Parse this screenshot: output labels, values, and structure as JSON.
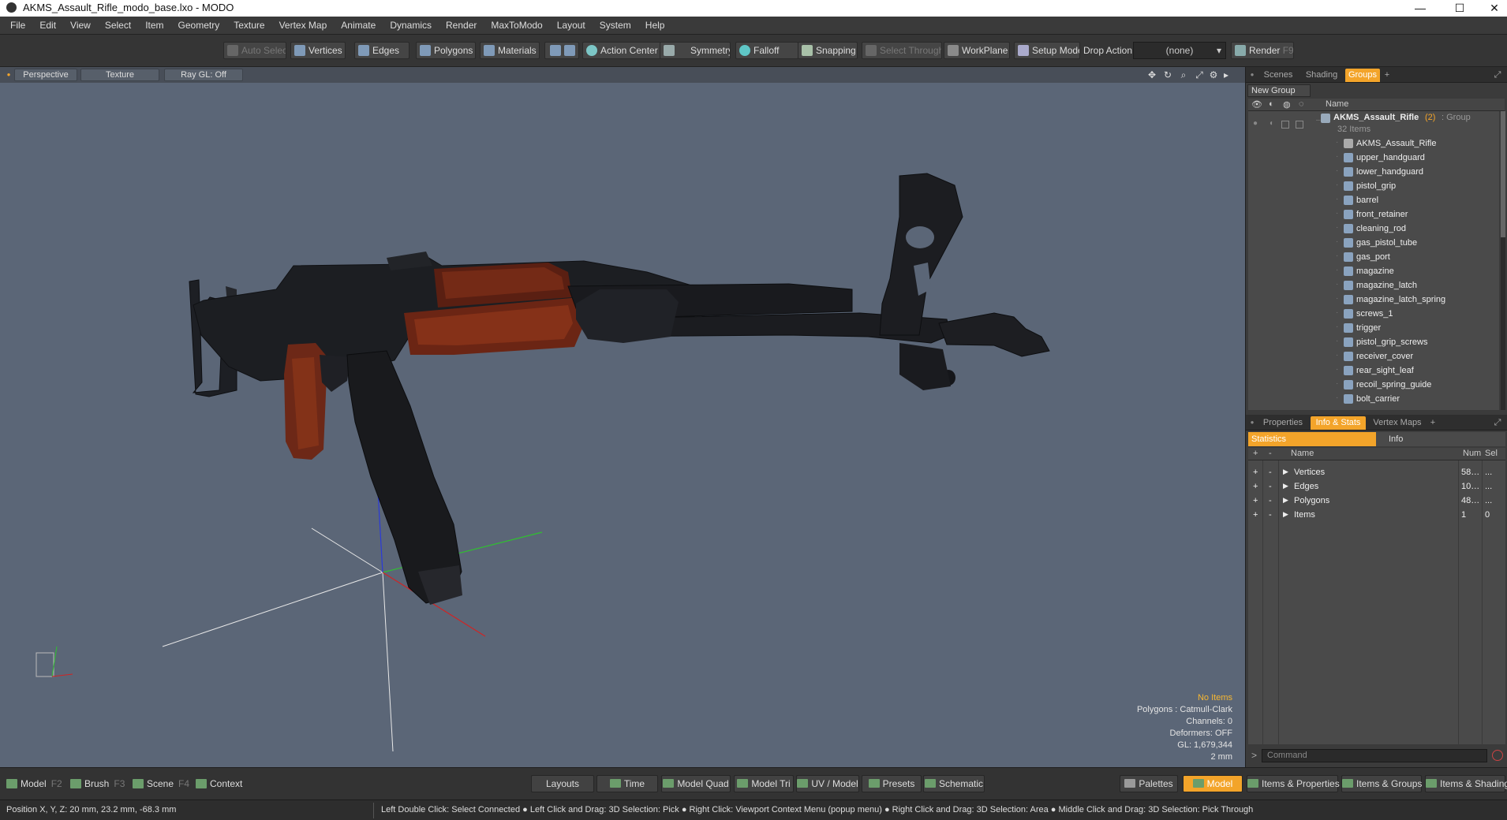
{
  "window": {
    "title": "AKMS_Assault_Rifle_modo_base.lxo - MODO",
    "minimize": "—",
    "maximize": "☐",
    "close": "✕"
  },
  "menu": [
    "File",
    "Edit",
    "View",
    "Select",
    "Item",
    "Geometry",
    "Texture",
    "Vertex Map",
    "Animate",
    "Dynamics",
    "Render",
    "MaxToModo",
    "Layout",
    "System",
    "Help"
  ],
  "toolbar": {
    "auto_select": "Auto Select",
    "vertices": "Vertices",
    "edges": "Edges",
    "polygons": "Polygons",
    "materials": "Materials",
    "action_center": "Action Center",
    "symmetry": "Symmetry",
    "falloff": "Falloff",
    "snapping": "Snapping",
    "select_through": "Select Through",
    "workplane": "WorkPlane",
    "setup_mode": "Setup Mode",
    "drop_action_label": "Drop Action",
    "drop_action_value": "(none)",
    "render": "Render",
    "render_key": "F9"
  },
  "viewport": {
    "perspective": "Perspective",
    "texture": "Texture",
    "raygl": "Ray GL: Off",
    "stats": {
      "no_items": "No Items",
      "polygons": "Polygons : Catmull-Clark",
      "channels": "Channels: 0",
      "deformers": "Deformers: OFF",
      "gl": "GL: 1,679,344",
      "scale": "2 mm"
    }
  },
  "colors": {
    "accent": "#f3a42a",
    "viewport_bg": "#5b6677",
    "panel_bg": "#3b3b3b"
  },
  "groups_panel": {
    "tabs": [
      "Scenes",
      "Shading",
      "Groups"
    ],
    "active_tab": "Groups",
    "new_group": "New Group",
    "column_name": "Name",
    "group": {
      "name": "AKMS_Assault_Rifle",
      "count": "(2)",
      "type": ": Group",
      "items_label": "32 Items"
    },
    "items": [
      "AKMS_Assault_Rifle",
      "upper_handguard",
      "lower_handguard",
      "pistol_grip",
      "barrel",
      "front_retainer",
      "cleaning_rod",
      "gas_pistol_tube",
      "gas_port",
      "magazine",
      "magazine_latch",
      "magazine_latch_spring",
      "screws_1",
      "trigger",
      "pistol_grip_screws",
      "receiver_cover",
      "rear_sight_leaf",
      "recoil_spring_guide",
      "bolt_carrier"
    ]
  },
  "info_panel": {
    "tabs": [
      "Properties",
      "Info & Stats",
      "Vertex Maps"
    ],
    "active_tab": "Info & Stats",
    "statistics": "Statistics",
    "info": "Info",
    "headers": {
      "name": "Name",
      "num": "Num",
      "sel": "Sel"
    },
    "rows": [
      {
        "name": "Vertices",
        "num": "58…",
        "sel": "..."
      },
      {
        "name": "Edges",
        "num": "10…",
        "sel": "..."
      },
      {
        "name": "Polygons",
        "num": "48…",
        "sel": "..."
      },
      {
        "name": "Items",
        "num": "1",
        "sel": "0"
      }
    ],
    "command_placeholder": "Command"
  },
  "bottombar": {
    "model": "Model",
    "model_key": "F2",
    "brush": "Brush",
    "brush_key": "F3",
    "scene": "Scene",
    "scene_key": "F4",
    "context": "Context",
    "layouts": "Layouts",
    "time": "Time",
    "model_quad": "Model Quad",
    "model_tri": "Model Tri",
    "uv_model": "UV / Model",
    "presets": "Presets",
    "schematic": "Schematic",
    "palettes": "Palettes",
    "model_active": "Model",
    "items_properties": "Items & Properties",
    "items_groups": "Items & Groups",
    "items_shading": "Items & Shading"
  },
  "status": {
    "position": "Position X, Y, Z:   20 mm, 23.2 mm, -68.3 mm",
    "hint": "Left Double Click: Select Connected ● Left Click and Drag: 3D Selection: Pick ● Right Click: Viewport Context Menu (popup menu) ● Right Click and Drag: 3D Selection: Area ● Middle Click and Drag: 3D Selection: Pick Through"
  }
}
